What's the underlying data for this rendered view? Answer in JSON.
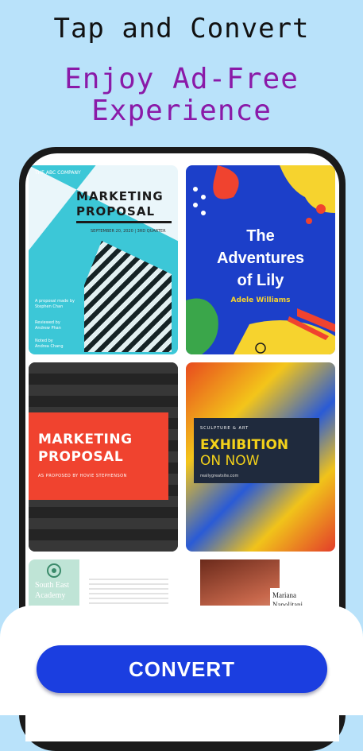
{
  "header": {
    "title": "Tap and Convert",
    "subtitle_line1": "Enjoy Ad-Free",
    "subtitle_line2": "Experience"
  },
  "templates": [
    {
      "logo": "THE ABC COMPANY",
      "title_line1": "MARKETING",
      "title_line2": "PROPOSAL",
      "date": "SEPTEMBER 20, 2020 | 3RD QUARTER",
      "prepared_by_label": "A proposal made by",
      "prepared_by": "Stephen Chan",
      "reviewed_by_label": "Reviewed by",
      "reviewed_by": "Andrew Phan",
      "noted_by_label": "Noted by",
      "noted_by": "Andrea Chang"
    },
    {
      "title_line1": "The",
      "title_line2": "Adventures",
      "title_line3": "of Lily",
      "author": "Adele Williams"
    },
    {
      "title_line1": "MARKETING",
      "title_line2": "PROPOSAL",
      "subtitle": "AS PROPOSED BY HOVIE STEPHENSON"
    },
    {
      "kicker": "SCULPTURE & ART",
      "title_line1": "EXHIBITION",
      "title_line2": "ON NOW",
      "url": "reallygreatsite.com"
    },
    {
      "title_line1": "South East",
      "title_line2": "Academy"
    },
    {
      "name_line1": "Mariana",
      "name_line2": "Napolitani"
    }
  ],
  "action": {
    "convert_label": "CONVERT"
  },
  "colors": {
    "background": "#b9e2fa",
    "subtitle": "#8a1aa8",
    "button": "#1b3ee0"
  }
}
